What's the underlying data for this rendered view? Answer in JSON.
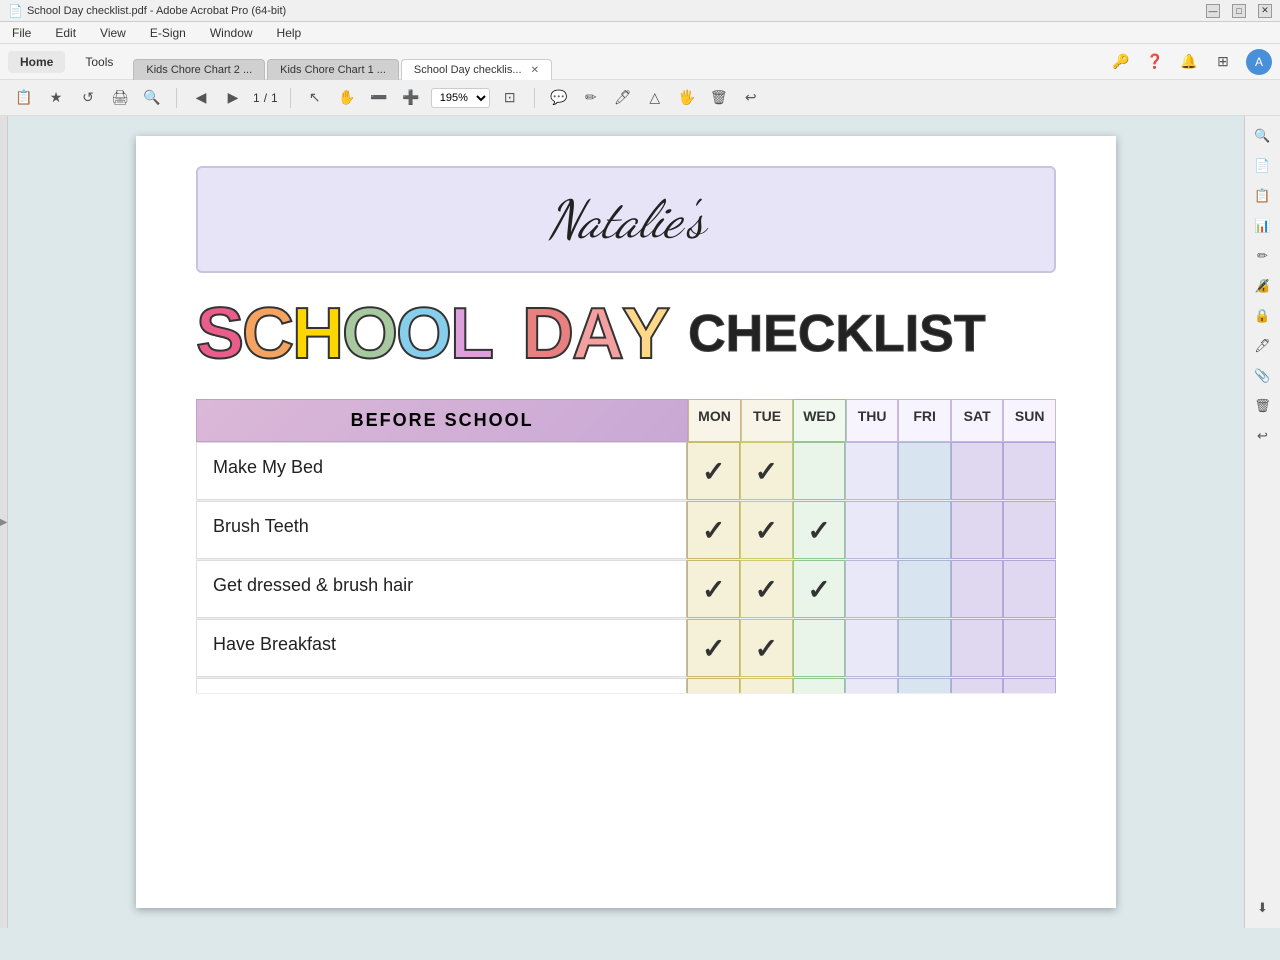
{
  "titleBar": {
    "title": "School Day checklist.pdf - Adobe Acrobat Pro (64-bit)",
    "windowBtns": [
      "—",
      "□",
      "✕"
    ]
  },
  "menuBar": {
    "items": [
      "File",
      "Edit",
      "View",
      "E-Sign",
      "Window",
      "Help"
    ]
  },
  "navBar": {
    "items": [
      "Home",
      "Tools"
    ],
    "tabs": [
      {
        "label": "Kids Chore Chart 2 ...",
        "active": false,
        "closeable": false
      },
      {
        "label": "Kids Chore Chart 1 ...",
        "active": false,
        "closeable": false
      },
      {
        "label": "School Day checklis...",
        "active": true,
        "closeable": true
      }
    ]
  },
  "toolbar": {
    "pageNav": {
      "current": "1",
      "total": "1"
    },
    "zoom": "195%"
  },
  "document": {
    "nameText": "Natalie's",
    "titleLine1": "SCHOOL DAY",
    "titleLine2": "CHECKLIST",
    "sectionHeader": "BEFORE SCHOOL",
    "days": [
      "MON",
      "TUE",
      "WED",
      "THU",
      "FRI",
      "SAT",
      "SUN"
    ],
    "tasks": [
      {
        "label": "Make My Bed",
        "checks": [
          true,
          true,
          false,
          false,
          false,
          false,
          false
        ]
      },
      {
        "label": "Brush Teeth",
        "checks": [
          true,
          true,
          true,
          false,
          false,
          false,
          false
        ]
      },
      {
        "label": "Get dressed & brush hair",
        "checks": [
          true,
          true,
          true,
          false,
          false,
          false,
          false
        ]
      },
      {
        "label": "Have Breakfast",
        "checks": [
          true,
          true,
          false,
          false,
          false,
          false,
          false
        ]
      }
    ]
  },
  "sidebarRight": {
    "icons": [
      "🔍",
      "📄",
      "📋",
      "📊",
      "✏️",
      "🔏",
      "🔒",
      "🖊️",
      "📎",
      "🗑️",
      "↩️",
      "⬇️"
    ]
  }
}
